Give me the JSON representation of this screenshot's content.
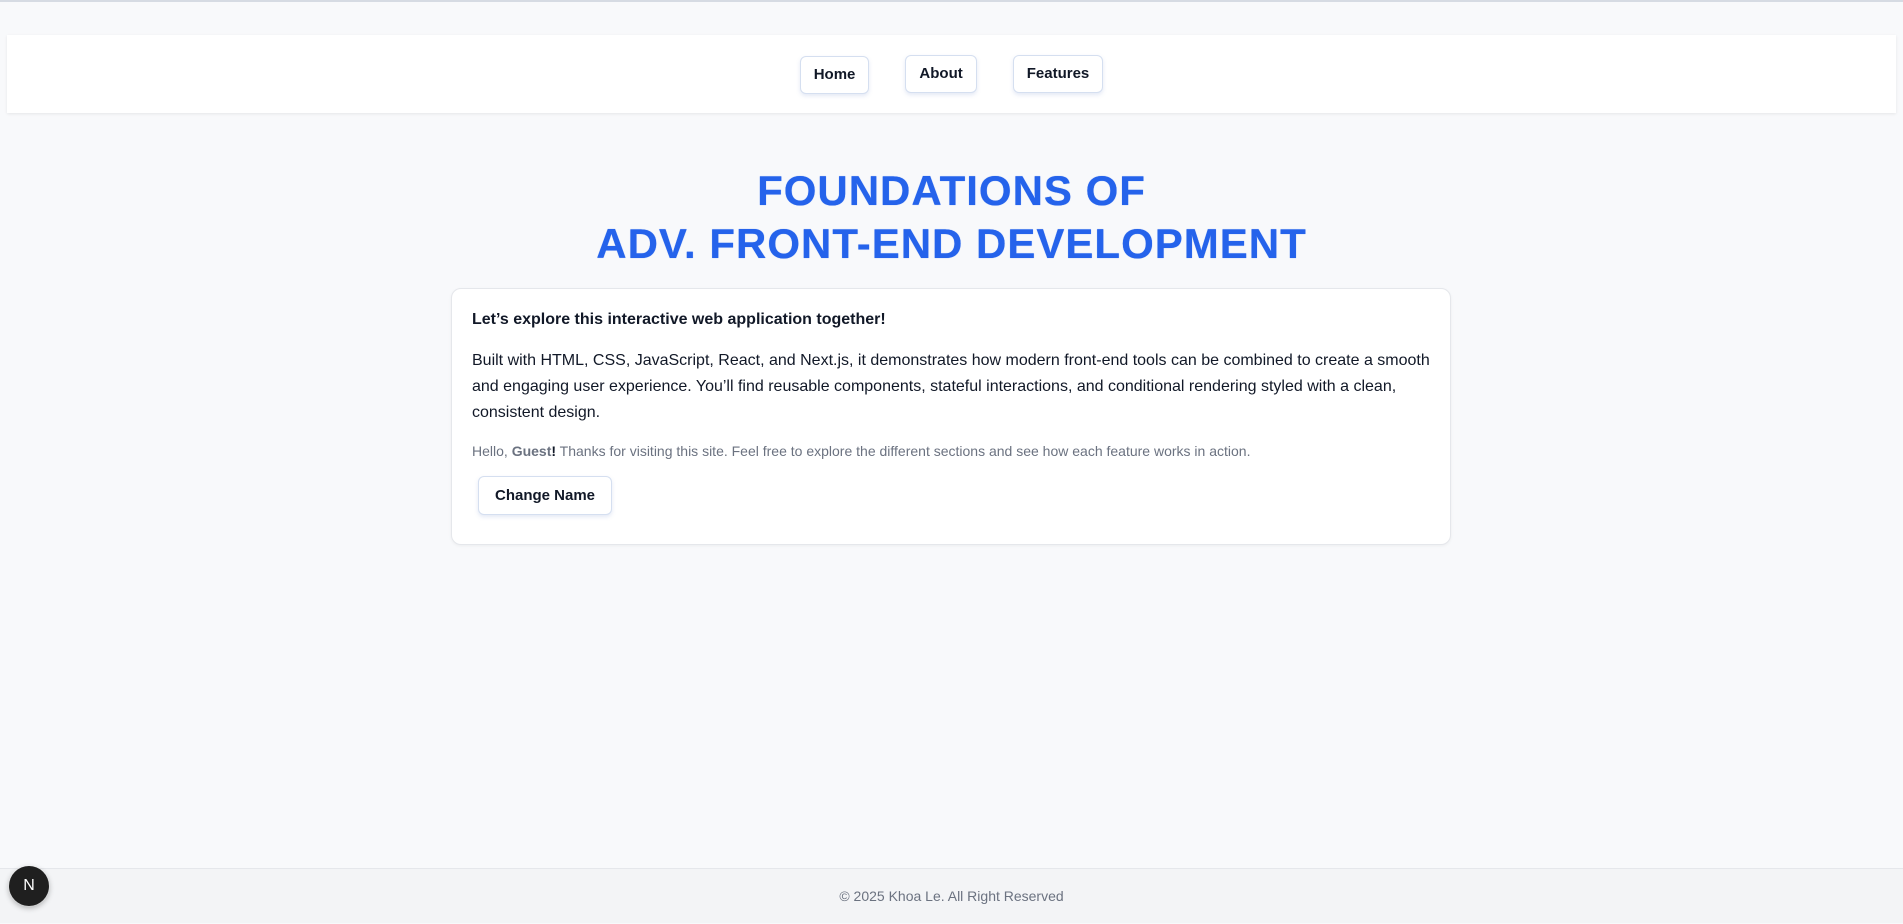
{
  "nav": {
    "items": [
      {
        "label": "Home"
      },
      {
        "label": "About"
      },
      {
        "label": "Features"
      }
    ]
  },
  "hero": {
    "title_line1": "FOUNDATIONS OF",
    "title_line2": "ADV. FRONT-END DEVELOPMENT",
    "title_color": "#2563eb"
  },
  "card": {
    "heading": "Let’s explore this interactive web application together!",
    "body": "Built with HTML, CSS, JavaScript, React, and Next.js, it demonstrates how modern front-end tools can be combined to create a smooth and engaging user experience. You’ll find reusable components, stateful interactions, and conditional rendering styled with a clean, consistent design.",
    "greeting_prefix": "Hello, ",
    "greeting_name": "Guest",
    "greeting_bang": "!",
    "greeting_suffix": " Thanks for visiting this site. Feel free to explore the different sections and see how each feature works in action.",
    "change_button_label": "Change Name"
  },
  "footer": {
    "text": "© 2025 Khoa Le. All Right Reserved"
  },
  "dev_badge": {
    "glyph": "N",
    "icon": "nextjs-icon"
  }
}
